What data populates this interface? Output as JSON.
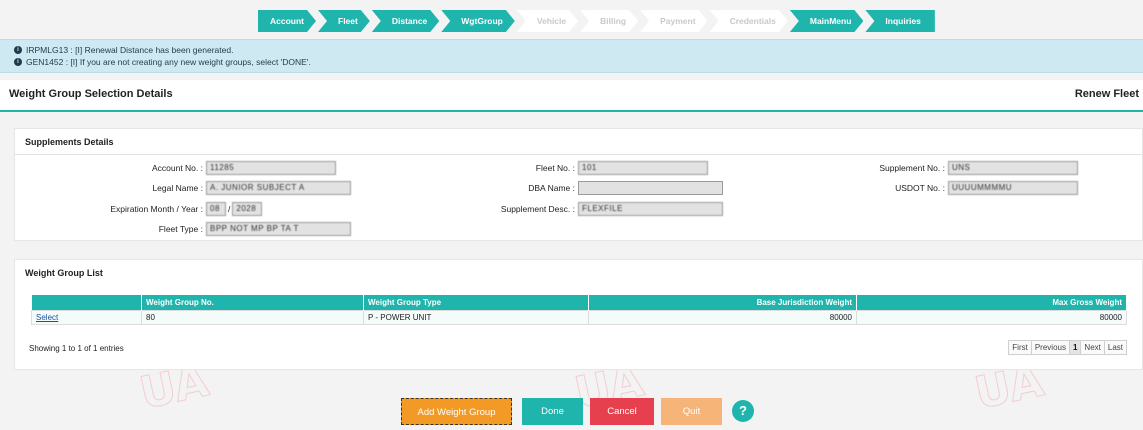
{
  "nav": {
    "steps": [
      {
        "label": "Account"
      },
      {
        "label": "Fleet"
      },
      {
        "label": "Distance"
      },
      {
        "label": "WgtGroup"
      },
      {
        "label": "Vehicle"
      },
      {
        "label": "Billing"
      },
      {
        "label": "Payment"
      },
      {
        "label": "Credentials"
      },
      {
        "label": "MainMenu"
      },
      {
        "label": "Inquiries"
      }
    ]
  },
  "messages": [
    {
      "text": "IRPMLG13 : [I] Renewal Distance has been generated."
    },
    {
      "text": "GEN1452 : [I] If you are not creating any new weight groups, select 'DONE'."
    }
  ],
  "header": {
    "title": "Weight Group Selection Details",
    "action": "Renew Fleet"
  },
  "supplements": {
    "title": "Supplements Details",
    "account_no": {
      "label": "Account No. :",
      "value": "11285"
    },
    "fleet_no": {
      "label": "Fleet No. :",
      "value": "101"
    },
    "supplement_no": {
      "label": "Supplement No. :",
      "value": "UNS"
    },
    "legal_name": {
      "label": "Legal Name :",
      "value": "A. JUNIOR SUBJECT A"
    },
    "dba_name": {
      "label": "DBA Name :",
      "value": ""
    },
    "usdot_no": {
      "label": "USDOT No. :",
      "value": "UUUUMMMMU"
    },
    "expiration": {
      "label": "Expiration Month / Year :",
      "month": "08",
      "separator": "/",
      "year": "2028"
    },
    "supplement_desc": {
      "label": "Supplement Desc. :",
      "value": "FLEXFILE"
    },
    "fleet_type": {
      "label": "Fleet Type :",
      "value": "BPP NOT MP BP TA T"
    }
  },
  "weight_groups": {
    "title": "Weight Group List",
    "columns": [
      "",
      "Weight Group No.",
      "Weight Group Type",
      "Base Jurisdiction Weight",
      "Max Gross Weight"
    ],
    "rows": [
      {
        "action": "Select",
        "no": "80",
        "type": "P - POWER UNIT",
        "base_weight": "80000",
        "max_gross": "80000"
      }
    ],
    "showing": "Showing 1 to 1 of 1 entries",
    "pager": [
      "First",
      "Previous",
      "1",
      "Next",
      "Last"
    ]
  },
  "watermark": "UA",
  "buttons": {
    "add": "Add Weight Group",
    "done": "Done",
    "cancel": "Cancel",
    "quit": "Quit",
    "help": "?"
  }
}
